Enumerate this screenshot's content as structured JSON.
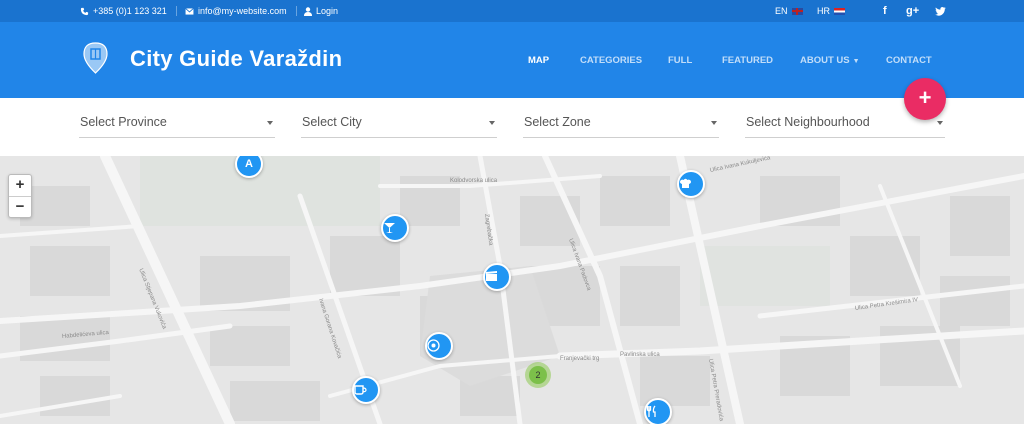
{
  "topbar": {
    "phone": "+385 (0)1 123 321",
    "email": "info@my-website.com",
    "login": "Login",
    "lang_en": "EN",
    "lang_hr": "HR",
    "social_facebook": "f",
    "social_google": "g+",
    "social_twitter": "t"
  },
  "header": {
    "title": "City Guide Varaždin",
    "nav": [
      "MAP",
      "CATEGORIES",
      "FULL",
      "FEATURED",
      "ABOUT US",
      "CONTACT"
    ],
    "active_nav": "MAP"
  },
  "filters": {
    "province": "Select Province",
    "city": "Select City",
    "zone": "Select Zone",
    "neighbourhood": "Select Neighbourhood",
    "add_button": "+"
  },
  "map": {
    "zoom_in": "+",
    "zoom_out": "−",
    "cluster_count": "2",
    "markers": [
      "road-sign-icon",
      "cocktail-icon",
      "cinema-icon",
      "compass-icon",
      "coffee-icon",
      "chef-hat-icon",
      "cutlery-icon"
    ],
    "streets": [
      "Kolodvorska ulica",
      "Ulica Ivana Kukuljevića",
      "Ulica Petra Preradovića",
      "Ulica Ivana Padovca",
      "Ulica Petra Krešimira IV",
      "Ulica Stjepana Vukovića",
      "Habdelićeva ulica",
      "Pavlinska ulica",
      "Franjevački trg",
      "Ivana Gorana Kovačića",
      "Zagrebačka"
    ]
  },
  "colors": {
    "topbar_bg": "#1a73cf",
    "header_bg": "#2185e8",
    "fab": "#ea2c64",
    "marker": "#2196f3",
    "cluster": "#7cc04a"
  }
}
